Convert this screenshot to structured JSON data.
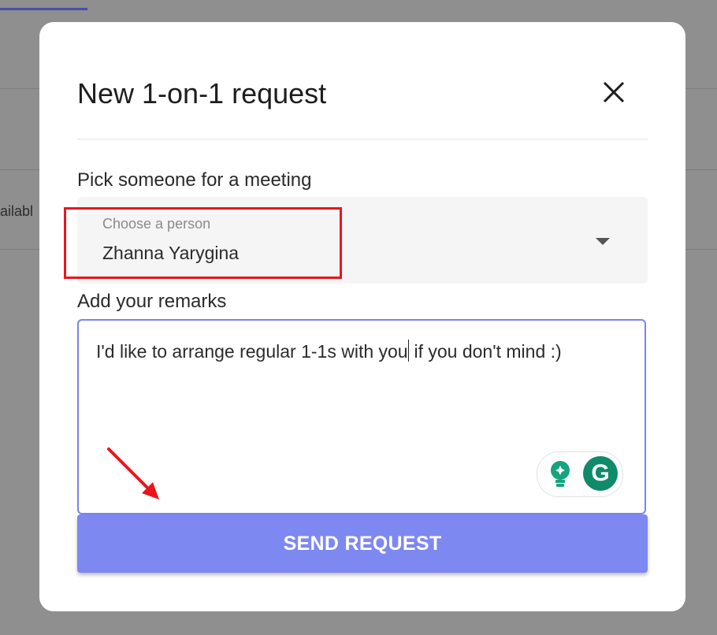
{
  "background": {
    "partial_text": "ailabl"
  },
  "modal": {
    "title": "New 1-on-1 request",
    "close_icon": "close-icon",
    "person_field": {
      "label": "Pick someone for a meeting",
      "floating_label": "Choose a person",
      "value": "Zhanna Yarygina",
      "dropdown_icon": "caret-down-icon"
    },
    "remarks_field": {
      "label": "Add your remarks",
      "text_before_caret": "I'd like to arrange regular 1-1s with you",
      "text_after_caret": " if you don't mind :)"
    },
    "grammarly": {
      "suggestion_icon": "lightbulb-icon",
      "logo_letter": "G"
    },
    "send_button_label": "SEND REQUEST"
  },
  "colors": {
    "accent": "#7d88f0",
    "field_border": "#7b83ef",
    "highlight": "#e8161c",
    "grammarly_green": "#0f8a6b"
  }
}
